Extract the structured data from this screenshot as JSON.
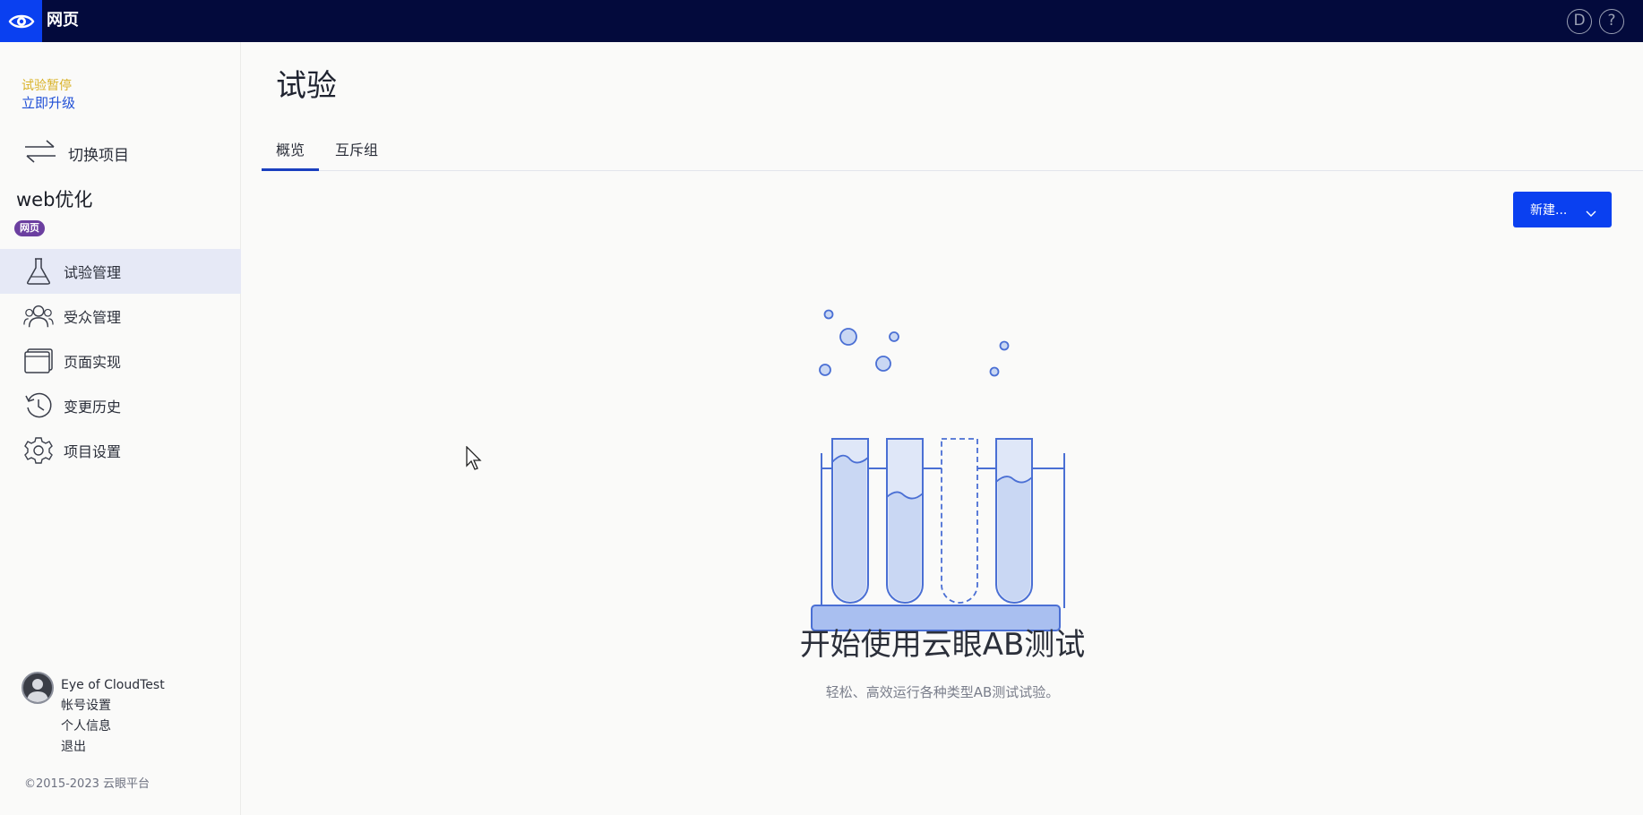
{
  "app": {
    "title": "网页"
  },
  "topbar": {
    "user_initial": "D",
    "help_glyph": "?"
  },
  "sidebar": {
    "trial_status": "试验暂停",
    "upgrade_label": "立即升级",
    "switch_project_label": "切换项目",
    "project_name": "web优化",
    "project_badge": "网页",
    "items": [
      {
        "label": "试验管理",
        "icon": "flask-icon",
        "active": true
      },
      {
        "label": "受众管理",
        "icon": "audience-icon",
        "active": false
      },
      {
        "label": "页面实现",
        "icon": "browser-window-icon",
        "active": false
      },
      {
        "label": "变更历史",
        "icon": "history-icon",
        "active": false
      },
      {
        "label": "项目设置",
        "icon": "gear-icon",
        "active": false
      }
    ],
    "user": {
      "name": "Eye of CloudTest",
      "links": [
        "帐号设置",
        "个人信息",
        "退出"
      ]
    },
    "copyright": "©2015-2023 云眼平台"
  },
  "main": {
    "title": "试验",
    "tabs": [
      {
        "label": "概览",
        "active": true
      },
      {
        "label": "互斥组",
        "active": false
      }
    ],
    "new_button_label": "新建...",
    "empty_state": {
      "title": "开始使用云眼AB测试",
      "subtitle": "轻松、高效运行各种类型AB测试试验。"
    }
  },
  "colors": {
    "topbar_bg": "#030a3c",
    "brand_blue": "#0a40f0",
    "trial_yellow": "#d9b227",
    "badge_purple": "#6b3fa0",
    "nav_active_bg": "#e6e9f6",
    "tab_underline": "#1a3fbf",
    "illustration_stroke": "#4a6fd4",
    "illustration_fill": "#c9d7f3"
  }
}
